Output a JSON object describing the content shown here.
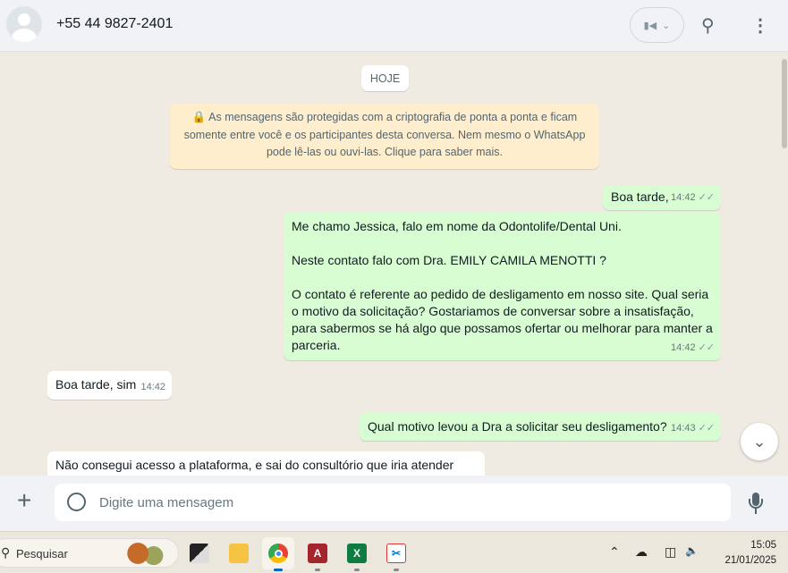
{
  "header": {
    "title": "+55 44 9827-2401",
    "video_icon": "video-camera-icon",
    "search_icon": "search-icon",
    "menu_icon": "kebab-menu-icon"
  },
  "chat": {
    "date_label": "HOJE",
    "encryption_notice": "As mensagens são protegidas com a criptografia de ponta a ponta e ficam somente entre você e os participantes desta conversa. Nem mesmo o WhatsApp pode lê-las ou ouvi-las. Clique para saber mais.",
    "messages": [
      {
        "direction": "out",
        "text": "Boa tarde,",
        "time": "14:42"
      },
      {
        "direction": "out",
        "paragraphs": [
          "Me chamo Jessica, falo em nome da Odontolife/Dental Uni.",
          "Neste contato falo com Dra. EMILY CAMILA MENOTTI ?",
          "O contato é referente ao pedido de desligamento em nosso site. Qual seria o motivo da solicitação? Gostariamos de conversar sobre a insatisfação, para sabermos se há algo que possamos ofertar ou melhorar para manter a parceria."
        ],
        "time": "14:42"
      },
      {
        "direction": "in",
        "text": "Boa tarde, sim",
        "time": "14:42"
      },
      {
        "direction": "out",
        "text": "Qual motivo levou a Dra a solicitar seu desligamento?",
        "time": "14:43"
      },
      {
        "direction": "in",
        "text": "Não consegui acesso a plataforma, e sai do consultório que iria atender"
      }
    ]
  },
  "composer": {
    "placeholder": "Digite uma mensagem"
  },
  "taskbar": {
    "search_placeholder": "Pesquisar",
    "time": "15:05",
    "date": "21/01/2025",
    "apps": [
      "task-view",
      "file-explorer",
      "chrome",
      "access",
      "excel",
      "snipping-tool"
    ]
  }
}
